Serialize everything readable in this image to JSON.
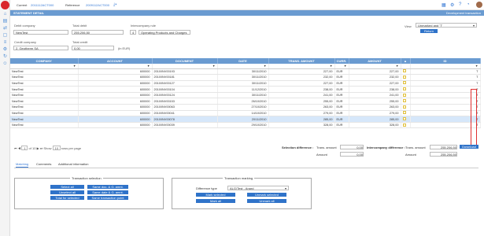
{
  "topbar": {
    "current_label": "Current",
    "current_ref": "2011112ACT000",
    "reference_label": "Reference",
    "reference_ref": "2009112ACT000"
  },
  "header": {
    "title": "STATEMENT DETAIL",
    "right": "Development transaction"
  },
  "form": {
    "debit_company_label": "Debit company",
    "debit_company": "NewTest",
    "total_debit_label": "Total debit",
    "total_debit": "255.206,50",
    "ic_rule_label": "Intercompany rule",
    "ic_rule_num": "4",
    "ic_rule": "Operating Products and Charges",
    "credit_company_label": "Credit company",
    "credit_company": "2. Geotherm SA",
    "total_credit_label": "Total credit",
    "total_credit": "0,00",
    "currency": "(in EUR)",
    "view_label": "View",
    "view_value": "Unmarked and 'T'",
    "return_label": "Return"
  },
  "columns": [
    "COMPANY",
    "ACCOUNT",
    "DOCUMENT",
    "DATE",
    "TRANS. AMOUNT",
    "CURR.",
    "AMOUNT",
    "▲",
    "ID"
  ],
  "rows": [
    {
      "company": "NewTest",
      "account": "600000",
      "document": "2010/INV00193",
      "date": "30/11/2010",
      "trans": "227,00",
      "curr": "EUR",
      "amount": "227,00",
      "id": "T"
    },
    {
      "company": "NewTest",
      "account": "600000",
      "document": "2010/INV00181",
      "date": "30/11/2010",
      "trans": "232,00",
      "curr": "EUR",
      "amount": "232,00",
      "id": "T"
    },
    {
      "company": "NewTest",
      "account": "600000",
      "document": "2010/INV00127",
      "date": "30/11/2010",
      "trans": "227,00",
      "curr": "EUR",
      "amount": "227,00",
      "id": "T"
    },
    {
      "company": "NewTest",
      "account": "600000",
      "document": "2010/INV00104",
      "date": "11/12/2010",
      "trans": "238,00",
      "curr": "EUR",
      "amount": "238,00",
      "id": "T"
    },
    {
      "company": "NewTest",
      "account": "600000",
      "document": "2010/INV00124",
      "date": "30/11/2010",
      "trans": "241,00",
      "curr": "EUR",
      "amount": "241,00",
      "id": "T"
    },
    {
      "company": "NewTest",
      "account": "600000",
      "document": "2010/INV00153",
      "date": "26/10/2010",
      "trans": "255,00",
      "curr": "EUR",
      "amount": "255,00",
      "id": "T"
    },
    {
      "company": "NewTest",
      "account": "600000",
      "document": "2010/INV00063",
      "date": "27/10/2010",
      "trans": "263,00",
      "curr": "EUR",
      "amount": "263,00",
      "id": "T"
    },
    {
      "company": "NewTest",
      "account": "600000",
      "document": "2010/INV00041",
      "date": "14/10/2010",
      "trans": "279,00",
      "curr": "EUR",
      "amount": "279,00",
      "id": "T"
    },
    {
      "company": "NewTest",
      "account": "600000",
      "document": "2010/INV00078",
      "date": "20/11/2010",
      "trans": "285,00",
      "curr": "EUR",
      "amount": "285,00",
      "id": "T"
    },
    {
      "company": "NewTest",
      "account": "600000",
      "document": "2010/INV00039",
      "date": "29/10/2010",
      "trans": "328,00",
      "curr": "EUR",
      "amount": "328,00",
      "id": "T"
    }
  ],
  "pager": {
    "page": "1",
    "of": "of 10",
    "show": "Show",
    "per_page": "10",
    "rows_label": "rows per page"
  },
  "summary": {
    "sel_diff": "Selection difference :",
    "trans_amount": "Trans. amount",
    "amount": "Amount",
    "v1": "0,00",
    "v2": "0,00",
    "ic_diff": "Intercompany difference :",
    "v3": "255.206,50",
    "v4": "255.206,50",
    "download": "Download"
  },
  "tabs": [
    "Matching",
    "Comments",
    "Additional information"
  ],
  "txsel": {
    "title": "Transaction selection",
    "b": [
      "Select all",
      "Same doc. & G. amnt.",
      "Unselect all",
      "Same date & G. amnt.",
      "Total for selected",
      "Same transaction point"
    ]
  },
  "txmark": {
    "title": "Transaction marking",
    "diff_label": "Difference type",
    "diff_value": "ALG/Test - Anard",
    "b": [
      "Mark selected",
      "Unmark selected",
      "Mark all",
      "Unmark all"
    ]
  }
}
